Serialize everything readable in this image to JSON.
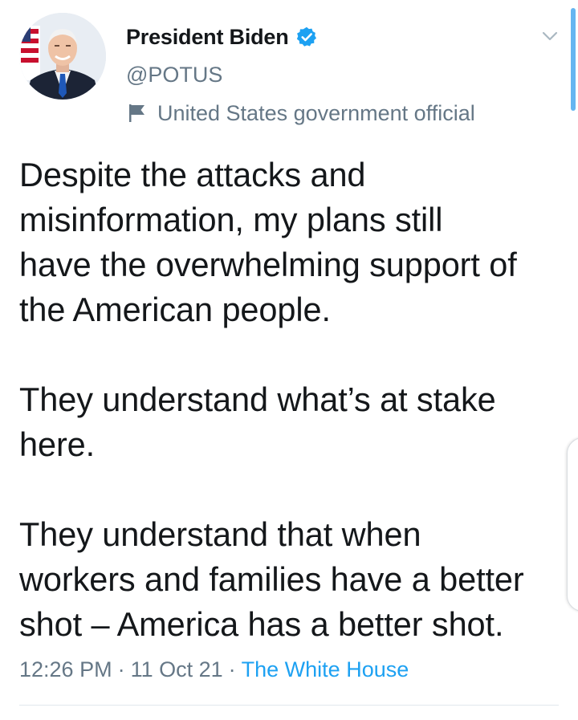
{
  "tweet": {
    "author": {
      "display_name": "President Biden",
      "handle": "@POTUS",
      "verified": true,
      "label": "United States government official"
    },
    "text": "Despite the attacks and\nmisinformation, my plans still\nhave the overwhelming support of\nthe American people.\n\nThey understand what’s at stake\nhere.\n\nThey understand that when\nworkers and families have a better\nshot – America has a better shot.",
    "time": "12:26 PM",
    "date": "11 Oct 21",
    "separator": "·",
    "source": "The White House"
  },
  "icons": {
    "verified": "verified-badge-icon",
    "label": "flag-icon",
    "menu": "chevron-down-icon"
  },
  "colors": {
    "text_primary": "#14171a",
    "text_secondary": "#657786",
    "accent": "#1da1f2",
    "divider": "#e1e8ed"
  }
}
